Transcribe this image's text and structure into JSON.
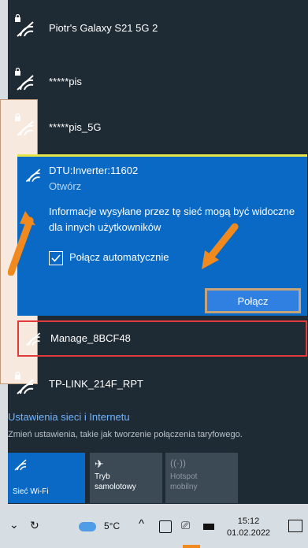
{
  "networks": [
    {
      "name": "Piotr's Galaxy S21 5G 2",
      "locked": true
    },
    {
      "name": "*****pis",
      "locked": true
    },
    {
      "name": "*****pis_5G",
      "locked": true
    }
  ],
  "expanded_network": {
    "name": "DTU:Inverter:11602",
    "status": "Otwórz",
    "info": "Informacje wysyłane przez tę sieć mogą być widoczne dla innych użytkowników",
    "auto_connect_label": "Połącz automatycznie",
    "auto_connect_checked": true,
    "connect_button": "Połącz"
  },
  "other_networks": [
    {
      "name": "Manage_8BCF48",
      "locked": false
    },
    {
      "name": "TP-LINK_214F_RPT",
      "locked": true
    }
  ],
  "settings": {
    "title": "Ustawienia sieci i Internetu",
    "subtitle": "Zmień ustawienia, takie jak tworzenie połączenia taryfowego."
  },
  "quick_tiles": [
    {
      "label": "Sieć Wi-Fi",
      "icon": "wifi-icon",
      "active": true
    },
    {
      "label": "Tryb samolotowy",
      "icon": "airplane-icon",
      "active": false
    },
    {
      "label": "Hotspot mobilny",
      "icon": "hotspot-icon",
      "active": false
    }
  ],
  "taskbar": {
    "temperature": "5°C",
    "time": "15:12",
    "date": "01.02.2022"
  },
  "colors": {
    "panel_bg": "#1f2b34",
    "accent_blue": "#0a69c4",
    "highlight_yellow": "#e8e54a",
    "highlight_red": "#e23a3a",
    "annotation_orange": "#f08a1e"
  }
}
